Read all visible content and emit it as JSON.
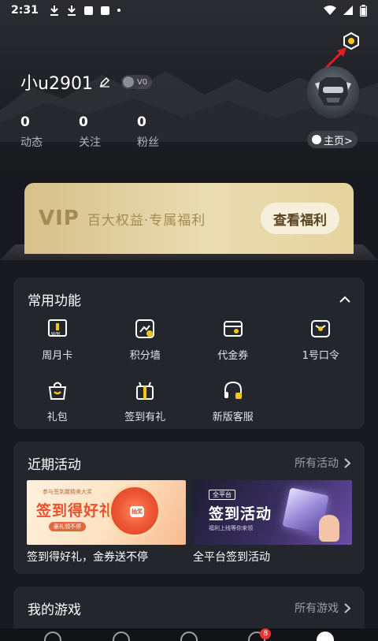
{
  "status_bar": {
    "time": "2:31"
  },
  "profile": {
    "username": "小u2901",
    "level": "V0",
    "stats": [
      {
        "value": "0",
        "label": "动态"
      },
      {
        "value": "0",
        "label": "关注"
      },
      {
        "value": "0",
        "label": "粉丝"
      }
    ],
    "home_button": "主页>"
  },
  "vip": {
    "label": "VIP",
    "description": "百大权益·专属福利",
    "button": "查看福利"
  },
  "features": {
    "title": "常用功能",
    "items": [
      {
        "label": "周月卡",
        "icon": "monthly-card-icon"
      },
      {
        "label": "积分墙",
        "icon": "points-wall-icon"
      },
      {
        "label": "代金券",
        "icon": "voucher-icon"
      },
      {
        "label": "1号口令",
        "icon": "password-icon"
      },
      {
        "label": "礼包",
        "icon": "gift-bag-icon"
      },
      {
        "label": "签到有礼",
        "icon": "checkin-gift-icon"
      },
      {
        "label": "新版客服",
        "icon": "customer-service-icon"
      }
    ]
  },
  "activities": {
    "title": "近期活动",
    "more": "所有活动",
    "banners": [
      {
        "caption": "签到得好礼，金券送不停",
        "headline": "签到得好礼",
        "small_top": "参与签到赢精美大奖",
        "sub": "豪礼领不停",
        "wheel_label": "抽奖"
      },
      {
        "caption": "全平台签到活动",
        "tag": "全平台",
        "headline": "签到活动",
        "sub": "福利上线等你来领"
      }
    ]
  },
  "games": {
    "title": "我的游戏",
    "more": "所有游戏"
  },
  "bottom_nav": {
    "badge": "8"
  },
  "colors": {
    "background": "#17191e",
    "card": "#24262d",
    "vip_gold": "#d6c08a",
    "accent_yellow": "#f5c518"
  }
}
